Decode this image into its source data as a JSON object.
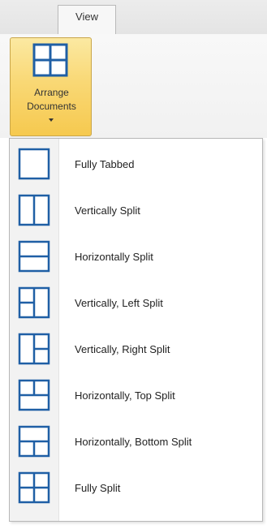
{
  "ribbon": {
    "tab_label": "View",
    "arrange_button": {
      "line1": "Arrange",
      "line2": "Documents",
      "icon": "grid-layout-icon"
    }
  },
  "menu": {
    "items": [
      {
        "label": "Fully Tabbed",
        "icon": "layout-fully-tabbed-icon"
      },
      {
        "label": "Vertically Split",
        "icon": "layout-vertical-split-icon"
      },
      {
        "label": "Horizontally Split",
        "icon": "layout-horizontal-split-icon"
      },
      {
        "label": "Vertically, Left Split",
        "icon": "layout-vertical-left-split-icon"
      },
      {
        "label": "Vertically, Right Split",
        "icon": "layout-vertical-right-split-icon"
      },
      {
        "label": "Horizontally, Top Split",
        "icon": "layout-horizontal-top-split-icon"
      },
      {
        "label": "Horizontally, Bottom Split",
        "icon": "layout-horizontal-bottom-split-icon"
      },
      {
        "label": "Fully Split",
        "icon": "layout-fully-split-icon"
      }
    ]
  },
  "colors": {
    "icon_stroke": "#1f5fa5",
    "button_highlight": "#f6c94f"
  }
}
